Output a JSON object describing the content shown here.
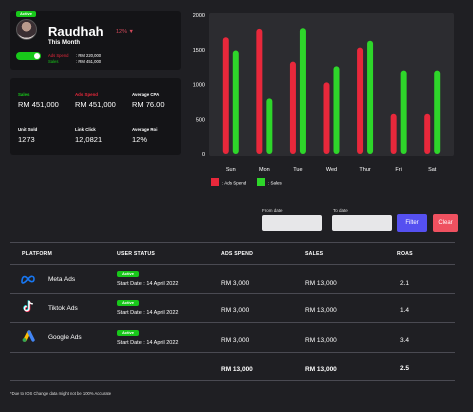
{
  "profile": {
    "active_label": "Active",
    "name": "Raudhah",
    "change_pct": "12% ▼",
    "period": "This Month",
    "ads_spend_label": "Ads Spend",
    "ads_spend_value": ": RM 220,000",
    "sales_label": "Sales",
    "sales_value": ": RM 451,000"
  },
  "stats": [
    {
      "label": "Sales",
      "value": "RM 451,000",
      "label_color": "#18c81a"
    },
    {
      "label": "Ads Spend",
      "value": "RM 451,000",
      "label_color": "#e8283b"
    },
    {
      "label": "Average CPA",
      "value": "RM 76.00",
      "label_color": "#ffffff"
    },
    {
      "label": "Unit Sold",
      "value": "1273",
      "label_color": "#ffffff"
    },
    {
      "label": "Link Click",
      "value": "12,0821",
      "label_color": "#ffffff"
    },
    {
      "label": "Average Roi",
      "value": "12%",
      "label_color": "#ffffff"
    }
  ],
  "chart_data": {
    "type": "bar",
    "categories": [
      "Sun",
      "Mon",
      "Tue",
      "Wed",
      "Thur",
      "Fri",
      "Sat"
    ],
    "series": [
      {
        "name": ": Ads Spend",
        "color": "#e8283b",
        "values": [
          1680,
          1800,
          1330,
          1030,
          1530,
          580,
          580
        ]
      },
      {
        "name": ": Sales",
        "color": "#2ed62a",
        "values": [
          1490,
          800,
          1810,
          1260,
          1630,
          1200,
          1200
        ]
      }
    ],
    "ylim": [
      0,
      2000
    ],
    "yticks": [
      0,
      500,
      1000,
      1500,
      2000
    ],
    "grid": false,
    "legend_position": "bottom-left"
  },
  "filter": {
    "from_label": "From date",
    "to_label": "To date",
    "filter_button": "Filter",
    "clear_button": "Clear",
    "filter_color": "#5550f0",
    "clear_color": "#ef5160"
  },
  "table": {
    "headers": [
      "PLATFORM",
      "USER STATUS",
      "ADS SPEND",
      "SALES",
      "ROAS"
    ],
    "rows": [
      {
        "icon": "meta-icon",
        "platform": "Meta Ads",
        "status": "Active",
        "start": "Start Date : 14 April 2022",
        "ads_spend": "RM 3,000",
        "sales": "RM 13,000",
        "roas": "2.1"
      },
      {
        "icon": "tiktok-icon",
        "platform": "Tiktok Ads",
        "status": "Active",
        "start": "Start Date : 14 April 2022",
        "ads_spend": "RM 3,000",
        "sales": "RM 13,000",
        "roas": "1.4"
      },
      {
        "icon": "google-ads-icon",
        "platform": "Google Ads",
        "status": "Active",
        "start": "Start Date : 14 April 2022",
        "ads_spend": "RM 3,000",
        "sales": "RM 13,000",
        "roas": "3.4"
      }
    ],
    "totals": {
      "ads_spend": "RM 13,000",
      "sales": "RM 13,000",
      "roas": "2.5"
    }
  },
  "footnote": "*Due to IOS Change data might not be 100% Accurate"
}
